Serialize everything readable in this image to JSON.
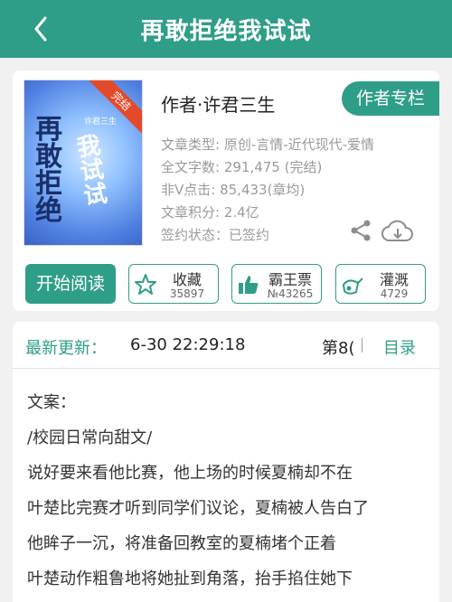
{
  "header": {
    "title": "再敢拒绝我试试"
  },
  "book": {
    "cover_badge": "完结",
    "cover_title_a": "再敢拒绝",
    "cover_title_b": "我试试",
    "cover_author": "许君三生",
    "author_line": "作者·许君三生",
    "author_column_label": "作者专栏",
    "meta": {
      "category": "文章类型: 原创-言情-近代现代-爱情",
      "word_count": "全文字数: 291,475 (完结)",
      "clicks": "非V点击: 85,433(章均)",
      "score": "文章积分: 2.4亿",
      "contract": "签约状态：已签约"
    }
  },
  "actions": {
    "read_label": "开始阅读",
    "favorite": {
      "label": "收藏",
      "count": "35897"
    },
    "overlord": {
      "label": "霸王票",
      "count": "№43265"
    },
    "irrigate": {
      "label": "灌溉",
      "count": "4729"
    }
  },
  "update": {
    "label": "最新更新：",
    "time": "6-30 22:29:18",
    "chapter": "第8(",
    "directory_label": "目录"
  },
  "description": {
    "lines": [
      "文案：",
      "/校园日常向甜文/",
      "说好要来看他比赛，他上场的时候夏楠却不在",
      "叶楚比完赛才听到同学们议论，夏楠被人告白了",
      "他眸子一沉，将准备回教室的夏楠堵个正着",
      "叶楚动作粗鲁地将她扯到角落，抬手掐住她下"
    ]
  },
  "colors": {
    "accent": "#2f9e88",
    "background": "#f1f1f1",
    "muted": "#9a9a9a"
  },
  "icons": [
    "back-arrow-icon",
    "share-icon",
    "cloud-download-icon",
    "star-icon",
    "thumbs-up-icon",
    "watering-can-icon"
  ]
}
